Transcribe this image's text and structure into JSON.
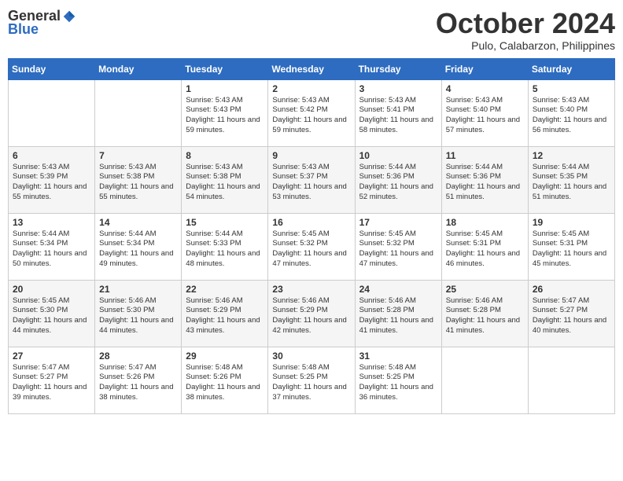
{
  "header": {
    "logo_general": "General",
    "logo_blue": "Blue",
    "month": "October 2024",
    "location": "Pulo, Calabarzon, Philippines"
  },
  "weekdays": [
    "Sunday",
    "Monday",
    "Tuesday",
    "Wednesday",
    "Thursday",
    "Friday",
    "Saturday"
  ],
  "weeks": [
    [
      {
        "day": "",
        "sunrise": "",
        "sunset": "",
        "daylight": ""
      },
      {
        "day": "",
        "sunrise": "",
        "sunset": "",
        "daylight": ""
      },
      {
        "day": "1",
        "sunrise": "Sunrise: 5:43 AM",
        "sunset": "Sunset: 5:43 PM",
        "daylight": "Daylight: 11 hours and 59 minutes."
      },
      {
        "day": "2",
        "sunrise": "Sunrise: 5:43 AM",
        "sunset": "Sunset: 5:42 PM",
        "daylight": "Daylight: 11 hours and 59 minutes."
      },
      {
        "day": "3",
        "sunrise": "Sunrise: 5:43 AM",
        "sunset": "Sunset: 5:41 PM",
        "daylight": "Daylight: 11 hours and 58 minutes."
      },
      {
        "day": "4",
        "sunrise": "Sunrise: 5:43 AM",
        "sunset": "Sunset: 5:40 PM",
        "daylight": "Daylight: 11 hours and 57 minutes."
      },
      {
        "day": "5",
        "sunrise": "Sunrise: 5:43 AM",
        "sunset": "Sunset: 5:40 PM",
        "daylight": "Daylight: 11 hours and 56 minutes."
      }
    ],
    [
      {
        "day": "6",
        "sunrise": "Sunrise: 5:43 AM",
        "sunset": "Sunset: 5:39 PM",
        "daylight": "Daylight: 11 hours and 55 minutes."
      },
      {
        "day": "7",
        "sunrise": "Sunrise: 5:43 AM",
        "sunset": "Sunset: 5:38 PM",
        "daylight": "Daylight: 11 hours and 55 minutes."
      },
      {
        "day": "8",
        "sunrise": "Sunrise: 5:43 AM",
        "sunset": "Sunset: 5:38 PM",
        "daylight": "Daylight: 11 hours and 54 minutes."
      },
      {
        "day": "9",
        "sunrise": "Sunrise: 5:43 AM",
        "sunset": "Sunset: 5:37 PM",
        "daylight": "Daylight: 11 hours and 53 minutes."
      },
      {
        "day": "10",
        "sunrise": "Sunrise: 5:44 AM",
        "sunset": "Sunset: 5:36 PM",
        "daylight": "Daylight: 11 hours and 52 minutes."
      },
      {
        "day": "11",
        "sunrise": "Sunrise: 5:44 AM",
        "sunset": "Sunset: 5:36 PM",
        "daylight": "Daylight: 11 hours and 51 minutes."
      },
      {
        "day": "12",
        "sunrise": "Sunrise: 5:44 AM",
        "sunset": "Sunset: 5:35 PM",
        "daylight": "Daylight: 11 hours and 51 minutes."
      }
    ],
    [
      {
        "day": "13",
        "sunrise": "Sunrise: 5:44 AM",
        "sunset": "Sunset: 5:34 PM",
        "daylight": "Daylight: 11 hours and 50 minutes."
      },
      {
        "day": "14",
        "sunrise": "Sunrise: 5:44 AM",
        "sunset": "Sunset: 5:34 PM",
        "daylight": "Daylight: 11 hours and 49 minutes."
      },
      {
        "day": "15",
        "sunrise": "Sunrise: 5:44 AM",
        "sunset": "Sunset: 5:33 PM",
        "daylight": "Daylight: 11 hours and 48 minutes."
      },
      {
        "day": "16",
        "sunrise": "Sunrise: 5:45 AM",
        "sunset": "Sunset: 5:32 PM",
        "daylight": "Daylight: 11 hours and 47 minutes."
      },
      {
        "day": "17",
        "sunrise": "Sunrise: 5:45 AM",
        "sunset": "Sunset: 5:32 PM",
        "daylight": "Daylight: 11 hours and 47 minutes."
      },
      {
        "day": "18",
        "sunrise": "Sunrise: 5:45 AM",
        "sunset": "Sunset: 5:31 PM",
        "daylight": "Daylight: 11 hours and 46 minutes."
      },
      {
        "day": "19",
        "sunrise": "Sunrise: 5:45 AM",
        "sunset": "Sunset: 5:31 PM",
        "daylight": "Daylight: 11 hours and 45 minutes."
      }
    ],
    [
      {
        "day": "20",
        "sunrise": "Sunrise: 5:45 AM",
        "sunset": "Sunset: 5:30 PM",
        "daylight": "Daylight: 11 hours and 44 minutes."
      },
      {
        "day": "21",
        "sunrise": "Sunrise: 5:46 AM",
        "sunset": "Sunset: 5:30 PM",
        "daylight": "Daylight: 11 hours and 44 minutes."
      },
      {
        "day": "22",
        "sunrise": "Sunrise: 5:46 AM",
        "sunset": "Sunset: 5:29 PM",
        "daylight": "Daylight: 11 hours and 43 minutes."
      },
      {
        "day": "23",
        "sunrise": "Sunrise: 5:46 AM",
        "sunset": "Sunset: 5:29 PM",
        "daylight": "Daylight: 11 hours and 42 minutes."
      },
      {
        "day": "24",
        "sunrise": "Sunrise: 5:46 AM",
        "sunset": "Sunset: 5:28 PM",
        "daylight": "Daylight: 11 hours and 41 minutes."
      },
      {
        "day": "25",
        "sunrise": "Sunrise: 5:46 AM",
        "sunset": "Sunset: 5:28 PM",
        "daylight": "Daylight: 11 hours and 41 minutes."
      },
      {
        "day": "26",
        "sunrise": "Sunrise: 5:47 AM",
        "sunset": "Sunset: 5:27 PM",
        "daylight": "Daylight: 11 hours and 40 minutes."
      }
    ],
    [
      {
        "day": "27",
        "sunrise": "Sunrise: 5:47 AM",
        "sunset": "Sunset: 5:27 PM",
        "daylight": "Daylight: 11 hours and 39 minutes."
      },
      {
        "day": "28",
        "sunrise": "Sunrise: 5:47 AM",
        "sunset": "Sunset: 5:26 PM",
        "daylight": "Daylight: 11 hours and 38 minutes."
      },
      {
        "day": "29",
        "sunrise": "Sunrise: 5:48 AM",
        "sunset": "Sunset: 5:26 PM",
        "daylight": "Daylight: 11 hours and 38 minutes."
      },
      {
        "day": "30",
        "sunrise": "Sunrise: 5:48 AM",
        "sunset": "Sunset: 5:25 PM",
        "daylight": "Daylight: 11 hours and 37 minutes."
      },
      {
        "day": "31",
        "sunrise": "Sunrise: 5:48 AM",
        "sunset": "Sunset: 5:25 PM",
        "daylight": "Daylight: 11 hours and 36 minutes."
      },
      {
        "day": "",
        "sunrise": "",
        "sunset": "",
        "daylight": ""
      },
      {
        "day": "",
        "sunrise": "",
        "sunset": "",
        "daylight": ""
      }
    ]
  ]
}
